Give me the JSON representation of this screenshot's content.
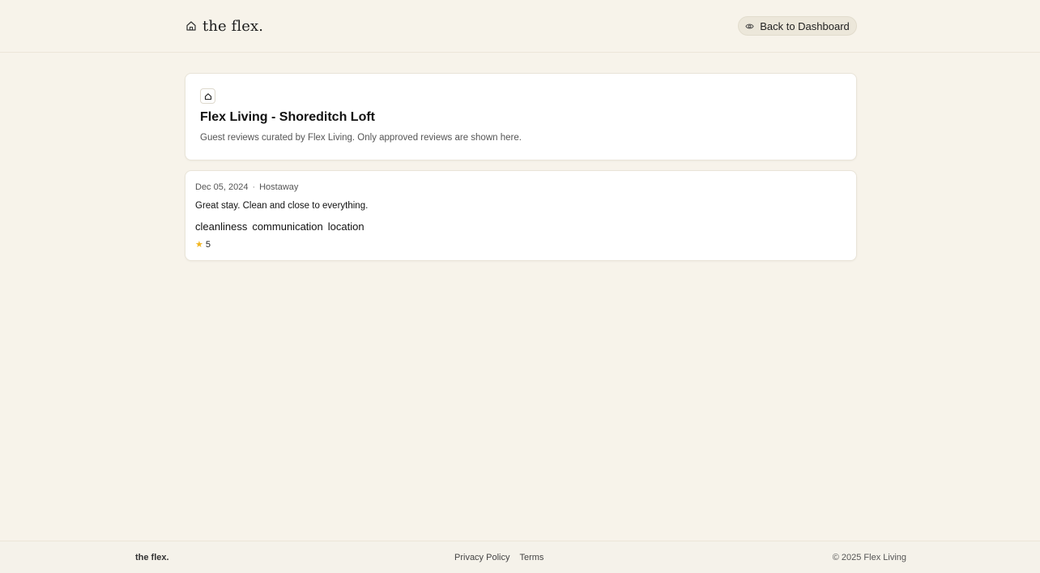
{
  "header": {
    "brand": "the flex.",
    "brand_icon": "home-outline-icon",
    "back_button_label": "Back to Dashboard",
    "back_button_icon": "eye-icon"
  },
  "property": {
    "icon": "home-icon",
    "title": "Flex Living - Shoreditch Loft",
    "subtitle": "Guest reviews curated by Flex Living. Only approved reviews are shown here."
  },
  "reviews": [
    {
      "date": "Dec 05, 2024",
      "separator": "·",
      "source": "Hostaway",
      "text": "Great stay. Clean and close to everything.",
      "tags": [
        "cleanliness",
        "communication",
        "location"
      ],
      "rating_icon": "star-icon",
      "rating": "5"
    }
  ],
  "footer": {
    "brand": "the flex.",
    "links": [
      "Privacy Policy",
      "Terms"
    ],
    "copyright": "© 2025 Flex Living"
  },
  "colors": {
    "background": "#f7f3ea",
    "card": "#ffffff",
    "button_bg": "#ece7da",
    "star": "#f2b51e"
  }
}
